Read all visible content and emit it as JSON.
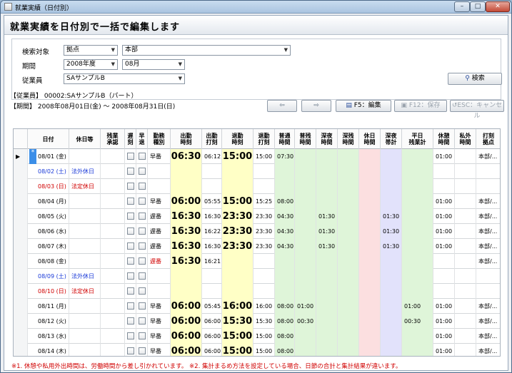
{
  "window": {
    "title": "就業実績（日付別）",
    "min": "–",
    "max": "□",
    "close": "✕"
  },
  "header": {
    "title": "就業実績を日付別で一括で編集します"
  },
  "search": {
    "target_label": "検索対象",
    "target_type": "拠点",
    "target_value": "本部",
    "period_label": "期間",
    "year": "2008年度",
    "month": "08月",
    "employee_label": "従業員",
    "employee": "SAサンプルB",
    "search_button": "検索"
  },
  "info": {
    "employee_line": "【従業員】 00002:SAサンプルB（パート）",
    "period_line": "【期間】   2008年08月01日(金) ～ 2008年08月31日(日)"
  },
  "toolbar": {
    "prev_icon": "⇦",
    "next_icon": "⇨",
    "f5": "F5：編集",
    "f12": "F12：保存",
    "esc": "ESC：キャンセル"
  },
  "columns": [
    "日付",
    "休日等",
    "残業承認",
    "遅刻",
    "早退",
    "勤務種別",
    "出勤時刻",
    "出勤打刻",
    "退勤時刻",
    "退勤打刻",
    "普通時間",
    "普残時間",
    "深夜時間",
    "深残時間",
    "休日時間",
    "深夜帯計",
    "平日残業計",
    "休憩時間",
    "私外時間",
    "打刻拠点"
  ],
  "rows": [
    {
      "date": "08/01 (金)",
      "holiday": "",
      "type": "早番",
      "in": "06:30",
      "in_punch": "06:12",
      "out": "15:00",
      "out_punch": "15:00",
      "normal": "07:30",
      "over": "",
      "night": "",
      "night_over": "",
      "holiday_time": "",
      "night_total": "",
      "weekday_over": "",
      "break": "01:00",
      "private": "",
      "site": "本部/...",
      "date_color": "black",
      "type_color": "black"
    },
    {
      "date": "08/02 (土)",
      "holiday": "法外休日",
      "type": "",
      "in": "",
      "in_punch": "",
      "out": "",
      "out_punch": "",
      "normal": "",
      "over": "",
      "night": "",
      "night_over": "",
      "holiday_time": "",
      "night_total": "",
      "weekday_over": "",
      "break": "",
      "private": "",
      "site": "",
      "date_color": "blue",
      "type_color": "black"
    },
    {
      "date": "08/03 (日)",
      "holiday": "法定休日",
      "type": "",
      "in": "",
      "in_punch": "",
      "out": "",
      "out_punch": "",
      "normal": "",
      "over": "",
      "night": "",
      "night_over": "",
      "holiday_time": "",
      "night_total": "",
      "weekday_over": "",
      "break": "",
      "private": "",
      "site": "",
      "date_color": "red",
      "type_color": "black"
    },
    {
      "date": "08/04 (月)",
      "holiday": "",
      "type": "早番",
      "in": "06:00",
      "in_punch": "05:55",
      "out": "15:00",
      "out_punch": "15:25",
      "normal": "08:00",
      "over": "",
      "night": "",
      "night_over": "",
      "holiday_time": "",
      "night_total": "",
      "weekday_over": "",
      "break": "01:00",
      "private": "",
      "site": "本部/...",
      "date_color": "black",
      "type_color": "black"
    },
    {
      "date": "08/05 (火)",
      "holiday": "",
      "type": "遅番",
      "in": "16:30",
      "in_punch": "16:30",
      "out": "23:30",
      "out_punch": "23:30",
      "normal": "04:30",
      "over": "",
      "night": "01:30",
      "night_over": "",
      "holiday_time": "",
      "night_total": "01:30",
      "weekday_over": "",
      "break": "01:00",
      "private": "",
      "site": "本部/...",
      "date_color": "black",
      "type_color": "black"
    },
    {
      "date": "08/06 (水)",
      "holiday": "",
      "type": "遅番",
      "in": "16:30",
      "in_punch": "16:22",
      "out": "23:30",
      "out_punch": "23:30",
      "normal": "04:30",
      "over": "",
      "night": "01:30",
      "night_over": "",
      "holiday_time": "",
      "night_total": "01:30",
      "weekday_over": "",
      "break": "01:00",
      "private": "",
      "site": "本部/...",
      "date_color": "black",
      "type_color": "black"
    },
    {
      "date": "08/07 (木)",
      "holiday": "",
      "type": "遅番",
      "in": "16:30",
      "in_punch": "16:30",
      "out": "23:30",
      "out_punch": "23:30",
      "normal": "04:30",
      "over": "",
      "night": "01:30",
      "night_over": "",
      "holiday_time": "",
      "night_total": "01:30",
      "weekday_over": "",
      "break": "01:00",
      "private": "",
      "site": "本部/...",
      "date_color": "black",
      "type_color": "black"
    },
    {
      "date": "08/08 (金)",
      "holiday": "",
      "type": "遅番",
      "in": "16:30",
      "in_punch": "16:21",
      "out": "",
      "out_punch": "",
      "normal": "",
      "over": "",
      "night": "",
      "night_over": "",
      "holiday_time": "",
      "night_total": "",
      "weekday_over": "",
      "break": "",
      "private": "",
      "site": "本部/...",
      "date_color": "black",
      "type_color": "red"
    },
    {
      "date": "08/09 (土)",
      "holiday": "法外休日",
      "type": "",
      "in": "",
      "in_punch": "",
      "out": "",
      "out_punch": "",
      "normal": "",
      "over": "",
      "night": "",
      "night_over": "",
      "holiday_time": "",
      "night_total": "",
      "weekday_over": "",
      "break": "",
      "private": "",
      "site": "",
      "date_color": "blue",
      "type_color": "black"
    },
    {
      "date": "08/10 (日)",
      "holiday": "法定休日",
      "type": "",
      "in": "",
      "in_punch": "",
      "out": "",
      "out_punch": "",
      "normal": "",
      "over": "",
      "night": "",
      "night_over": "",
      "holiday_time": "",
      "night_total": "",
      "weekday_over": "",
      "break": "",
      "private": "",
      "site": "",
      "date_color": "red",
      "type_color": "black"
    },
    {
      "date": "08/11 (月)",
      "holiday": "",
      "type": "早番",
      "in": "06:00",
      "in_punch": "05:45",
      "out": "16:00",
      "out_punch": "16:00",
      "normal": "08:00",
      "over": "01:00",
      "night": "",
      "night_over": "",
      "holiday_time": "",
      "night_total": "",
      "weekday_over": "01:00",
      "break": "01:00",
      "private": "",
      "site": "本部/...",
      "date_color": "black",
      "type_color": "black"
    },
    {
      "date": "08/12 (火)",
      "holiday": "",
      "type": "早番",
      "in": "06:00",
      "in_punch": "06:00",
      "out": "15:30",
      "out_punch": "15:30",
      "normal": "08:00",
      "over": "00:30",
      "night": "",
      "night_over": "",
      "holiday_time": "",
      "night_total": "",
      "weekday_over": "00:30",
      "break": "01:00",
      "private": "",
      "site": "本部/...",
      "date_color": "black",
      "type_color": "black"
    },
    {
      "date": "08/13 (水)",
      "holiday": "",
      "type": "早番",
      "in": "06:00",
      "in_punch": "06:00",
      "out": "15:00",
      "out_punch": "15:00",
      "normal": "08:00",
      "over": "",
      "night": "",
      "night_over": "",
      "holiday_time": "",
      "night_total": "",
      "weekday_over": "",
      "break": "01:00",
      "private": "",
      "site": "本部/...",
      "date_color": "black",
      "type_color": "black"
    },
    {
      "date": "08/14 (木)",
      "holiday": "",
      "type": "早番",
      "in": "06:00",
      "in_punch": "06:00",
      "out": "15:00",
      "out_punch": "15:00",
      "normal": "08:00",
      "over": "",
      "night": "",
      "night_over": "",
      "holiday_time": "",
      "night_total": "",
      "weekday_over": "",
      "break": "01:00",
      "private": "",
      "site": "本部/...",
      "date_color": "black",
      "type_color": "black"
    }
  ],
  "current_row_marker": "▶",
  "new_row_marker": "*",
  "note": "※1. 休憩や私用外出時間は、労働時間から差し引かれています。 ※2. 集計まるめ方法を設定している場合、日節の合計と集計結果が違います。",
  "colors": {
    "yellow": "#ffffc6",
    "green": "#dff5d9",
    "pink": "#fcdfe0",
    "lavender": "#e2e2fb",
    "red": "#d00000",
    "blue": "#1a3ad8"
  }
}
